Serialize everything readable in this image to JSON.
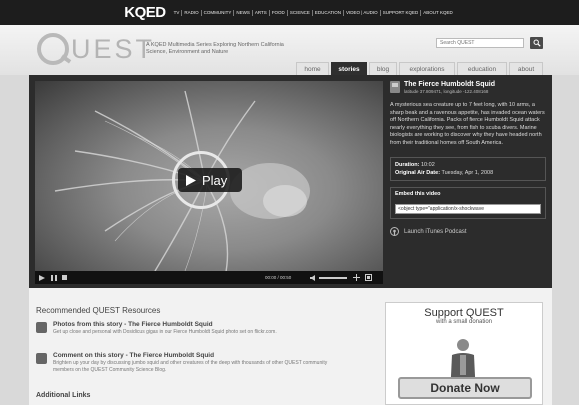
{
  "topbar": {
    "logo": "KQED",
    "nav": [
      "TV",
      "RADIO",
      "COMMUNITY",
      "NEWS",
      "ARTS",
      "FOOD",
      "SCIENCE",
      "EDUCATION",
      "VIDEO | AUDIO",
      "SUPPORT KQED",
      "ABOUT KQED"
    ]
  },
  "header": {
    "logo_text": "UEST",
    "tagline": "A KQED Multimedia Series Exploring Northern California Science, Environment and Nature",
    "search_placeholder": "Search QUEST",
    "tabs": [
      {
        "label": "home",
        "active": false
      },
      {
        "label": "stories",
        "active": true
      },
      {
        "label": "blog",
        "active": false
      },
      {
        "label": "explorations",
        "active": false
      },
      {
        "label": "education",
        "active": false
      },
      {
        "label": "about",
        "active": false
      }
    ]
  },
  "video": {
    "play_label": "Play",
    "time": "00:00 / 00:50"
  },
  "side": {
    "title": "The Fierce Humboldt Squid",
    "subtitle": "latitude 37.809471, longitude -122.408168",
    "description": "A mysterious sea creature up to 7 feet long, with 10 arms, a sharp beak and a ravenous appetite, has invaded ocean waters off Northern California. Packs of fierce Humboldt Squid attack nearly everything they see, from fish to scuba divers. Marine biologists are working to discover why they have headed north from their traditional homes off South America.",
    "duration_label": "Duration:",
    "duration": "10:02",
    "airdate_label": "Original Air Date:",
    "airdate": "Tuesday, Apr 1, 2008",
    "embed_label": "Embed this video",
    "embed_code": "<object type=\"application/x-shockwave",
    "itunes": "Launch iTunes Podcast"
  },
  "recommended": {
    "title": "Recommended QUEST Resources",
    "items": [
      {
        "head": "Photos from this story - The Fierce Humboldt Squid",
        "body": "Get up close and personal with Dosidicus gigas in our Fierce Humboldt Squid photo set on flickr.com."
      },
      {
        "head": "Comment on this story - The Fierce Humboldt Squid",
        "body": "Brighten up your day by discussing jumbo squid and other creatures of the deep with thousands of other QUEST community members on the QUEST Community Science Blog."
      }
    ],
    "additional": "Additional Links"
  },
  "support": {
    "title": "Support QUEST",
    "subtitle": "with a small donation",
    "donate": "Donate Now"
  },
  "colors": {
    "topbar": "#1d1d1d",
    "panel": "#2c2c2c",
    "active_tab": "#2f2f2f"
  }
}
